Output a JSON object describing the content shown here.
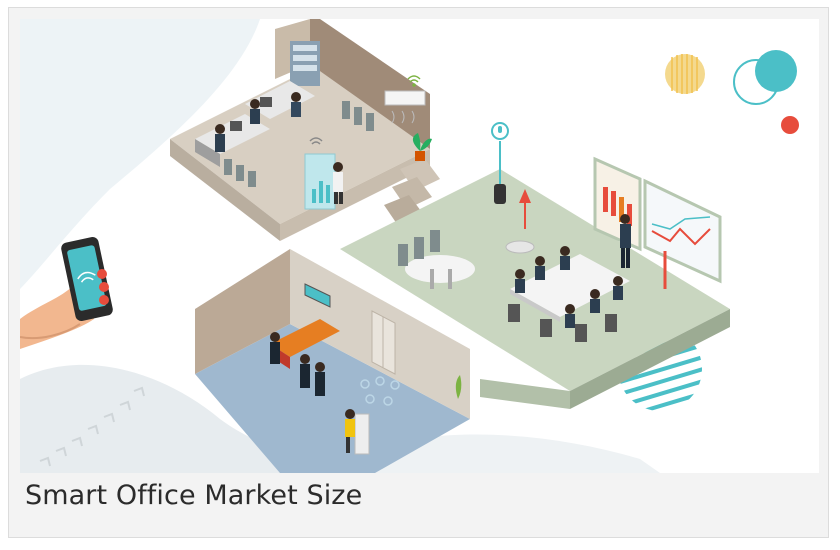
{
  "card": {
    "caption": "Smart Office Market Size"
  },
  "illustration": {
    "icons": [
      "smartphone-icon",
      "wifi-icon",
      "microphone-icon",
      "smart-speaker-icon",
      "bar-chart-icon",
      "line-chart-icon",
      "plant-icon",
      "air-conditioner-icon"
    ],
    "colors": {
      "accent_teal": "#4bbfc7",
      "accent_red": "#e74c3c",
      "accent_yellow": "#f2d27a",
      "floor_green": "#c9d6c0",
      "floor_blue": "#9fb8cf",
      "floor_beige": "#d8cfc2",
      "wall_brown": "#a08b78"
    }
  }
}
